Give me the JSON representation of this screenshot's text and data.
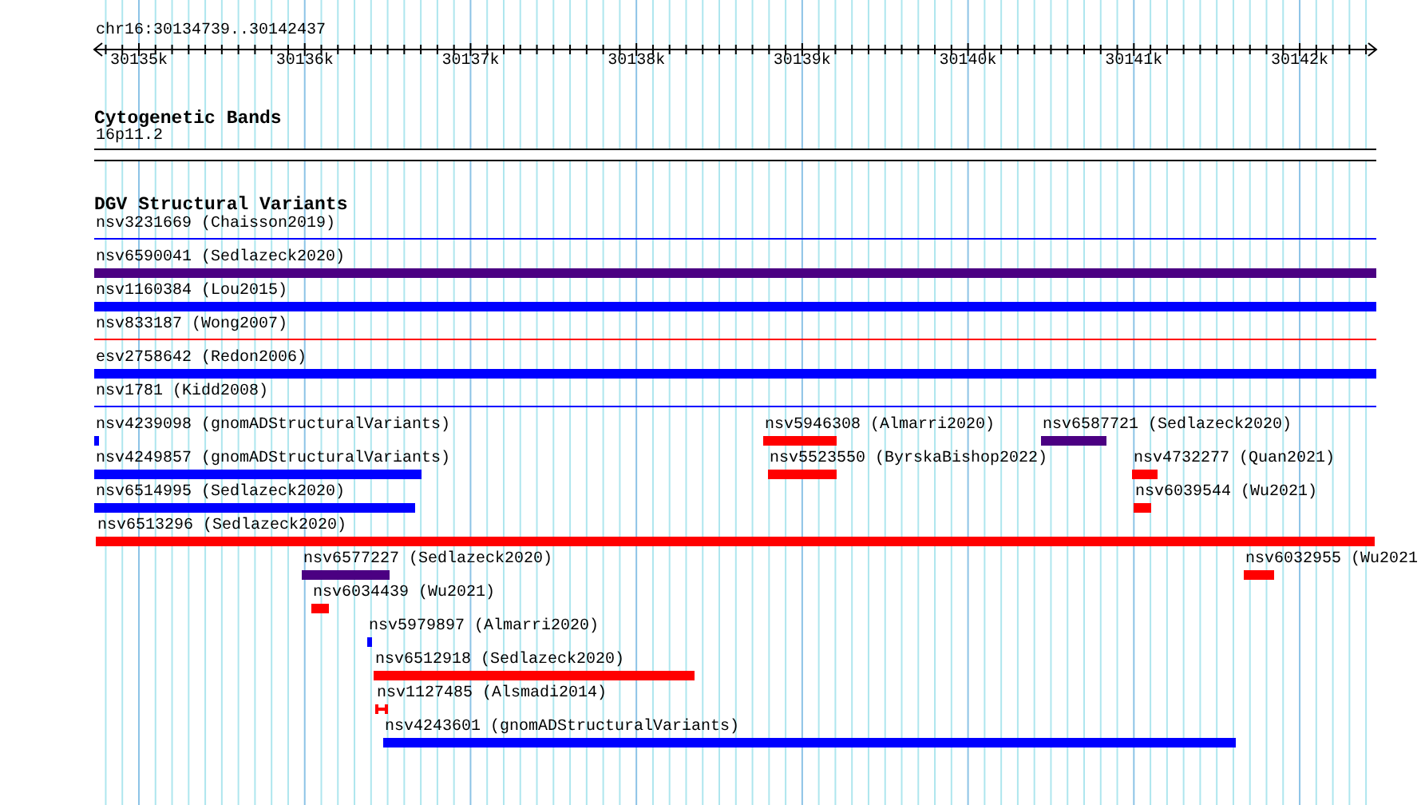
{
  "ruler": {
    "location": "chr16:30134739..30142437",
    "ticks": [
      "30135k",
      "30136k",
      "30137k",
      "30138k",
      "30139k",
      "30140k",
      "30141k",
      "30142k"
    ]
  },
  "tracks": [
    {
      "title": "Cytogenetic Bands",
      "features": [
        {
          "label": "16p11.2",
          "kind": "band"
        }
      ]
    },
    {
      "title": "DGV Structural Variants",
      "features": [
        {
          "label": "nsv3231669 (Chaisson2019)",
          "kind": "line",
          "color": "#0000ff"
        },
        {
          "label": "nsv6590041 (Sedlazeck2020)",
          "kind": "bar",
          "color": "#4b0082"
        },
        {
          "label": "nsv1160384 (Lou2015)",
          "kind": "bar",
          "color": "#0000ff"
        },
        {
          "label": "nsv833187 (Wong2007)",
          "kind": "line",
          "color": "#ff0000"
        },
        {
          "label": "esv2758642 (Redon2006)",
          "kind": "bar",
          "color": "#0000ff"
        },
        {
          "label": "nsv1781 (Kidd2008)",
          "kind": "line",
          "color": "#0000ff"
        },
        {
          "label": "nsv4239098 (gnomADStructuralVariants)",
          "kind": "bar",
          "color": "#0000ff"
        },
        {
          "label": "nsv5946308 (Almarri2020)",
          "kind": "bar",
          "color": "#ff0000"
        },
        {
          "label": "nsv6587721 (Sedlazeck2020)",
          "kind": "bar",
          "color": "#4b0082"
        },
        {
          "label": "nsv4249857 (gnomADStructuralVariants)",
          "kind": "bar",
          "color": "#0000ff"
        },
        {
          "label": "nsv5523550 (ByrskaBishop2022)",
          "kind": "bar",
          "color": "#ff0000"
        },
        {
          "label": "nsv4732277 (Quan2021)",
          "kind": "bar",
          "color": "#ff0000"
        },
        {
          "label": "nsv6514995 (Sedlazeck2020)",
          "kind": "bar",
          "color": "#0000ff"
        },
        {
          "label": "nsv6039544 (Wu2021)",
          "kind": "bar",
          "color": "#ff0000"
        },
        {
          "label": "nsv6513296 (Sedlazeck2020)",
          "kind": "bar",
          "color": "#ff0000"
        },
        {
          "label": "nsv6577227 (Sedlazeck2020)",
          "kind": "bar",
          "color": "#4b0082"
        },
        {
          "label": "nsv6032955 (Wu2021",
          "kind": "bar",
          "color": "#ff0000"
        },
        {
          "label": "nsv6034439 (Wu2021)",
          "kind": "bar",
          "color": "#ff0000"
        },
        {
          "label": "nsv5979897 (Almarri2020)",
          "kind": "bar",
          "color": "#0000ff"
        },
        {
          "label": "nsv6512918 (Sedlazeck2020)",
          "kind": "bar",
          "color": "#ff0000"
        },
        {
          "label": "nsv1127485 (Alsmadi2014)",
          "kind": "span",
          "color": "#ff0000"
        },
        {
          "label": "nsv4243601 (gnomADStructuralVariants)",
          "kind": "bar",
          "color": "#0000ff"
        }
      ]
    }
  ]
}
